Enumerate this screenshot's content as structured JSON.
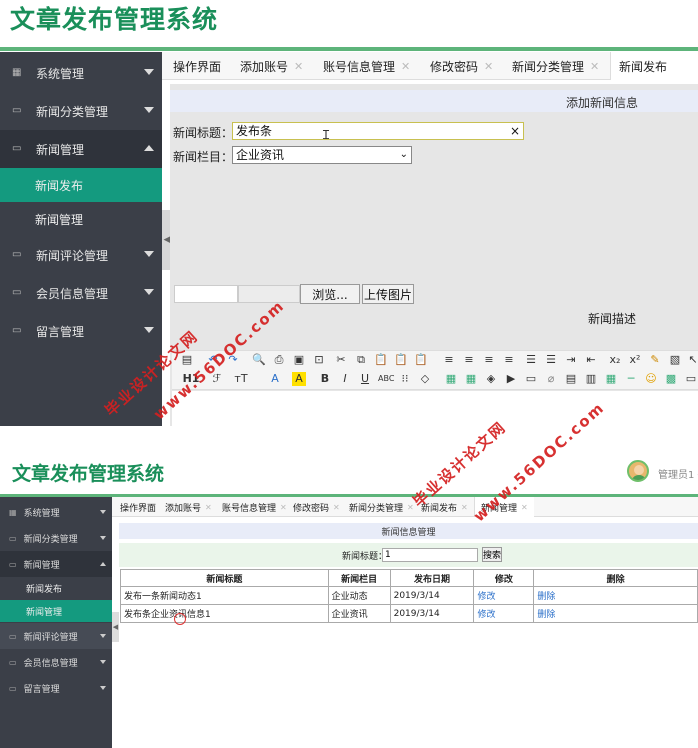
{
  "screen1": {
    "app_title": "文章发布管理系统",
    "sidebar": {
      "items": [
        {
          "label": "系统管理",
          "icon": "grid-icon",
          "state": "collapsed"
        },
        {
          "label": "新闻分类管理",
          "icon": "monitor-icon",
          "state": "collapsed"
        },
        {
          "label": "新闻管理",
          "icon": "monitor-icon",
          "state": "expanded"
        },
        {
          "label": "新闻评论管理",
          "icon": "monitor-icon",
          "state": "collapsed"
        },
        {
          "label": "会员信息管理",
          "icon": "monitor-icon",
          "state": "collapsed"
        },
        {
          "label": "留言管理",
          "icon": "monitor-icon",
          "state": "collapsed"
        }
      ],
      "subitems": [
        {
          "label": "新闻发布",
          "active": true
        },
        {
          "label": "新闻管理",
          "active": false
        }
      ]
    },
    "tabs": [
      "操作界面",
      "添加账号",
      "账号信息管理",
      "修改密码",
      "新闻分类管理",
      "新闻发布"
    ],
    "form": {
      "header": "添加新闻信息",
      "title_label": "新闻标题：",
      "title_value": "发布条",
      "clear_glyph": "×",
      "column_label": "新闻栏目：",
      "column_value": "企业资讯",
      "browse_label": "浏览...",
      "upload_label": "上传图片",
      "desc_label": "新闻描述",
      "heading_button": "H1"
    }
  },
  "screen2": {
    "app_title": "文章发布管理系统",
    "admin_label": "管理员1",
    "sidebar": {
      "items": [
        {
          "label": "系统管理",
          "state": "collapsed"
        },
        {
          "label": "新闻分类管理",
          "state": "collapsed"
        },
        {
          "label": "新闻管理",
          "state": "expanded"
        },
        {
          "label": "新闻评论管理",
          "state": "collapsed"
        },
        {
          "label": "会员信息管理",
          "state": "collapsed"
        },
        {
          "label": "留言管理",
          "state": "collapsed"
        }
      ],
      "subitems": [
        {
          "label": "新闻发布",
          "active": false
        },
        {
          "label": "新闻管理",
          "active": true
        }
      ]
    },
    "tabs": [
      "操作界面",
      "添加账号",
      "账号信息管理",
      "修改密码",
      "新闻分类管理",
      "新闻发布",
      "新闻管理"
    ],
    "panel_header": "新闻信息管理",
    "search": {
      "label": "新闻标题：",
      "value": "1",
      "button": "搜索"
    },
    "table": {
      "headers": [
        "新闻标题",
        "新闻栏目",
        "发布日期",
        "修改",
        "删除"
      ],
      "rows": [
        [
          "发布一条新闻动态1",
          "企业动态",
          "2019/3/14",
          "修改",
          "删除"
        ],
        [
          "发布条企业资讯信息1",
          "企业资讯",
          "2019/3/14",
          "修改",
          "删除"
        ]
      ]
    }
  },
  "watermark": {
    "line1": "毕业设计论文网",
    "line2": "www.56DOC.com"
  },
  "colors": {
    "brand_green": "#1a8f5a",
    "sidebar_bg": "#3b3f48",
    "active_teal": "#149a7f",
    "link_blue": "#2a6fc9",
    "watermark_red": "#d42020"
  }
}
